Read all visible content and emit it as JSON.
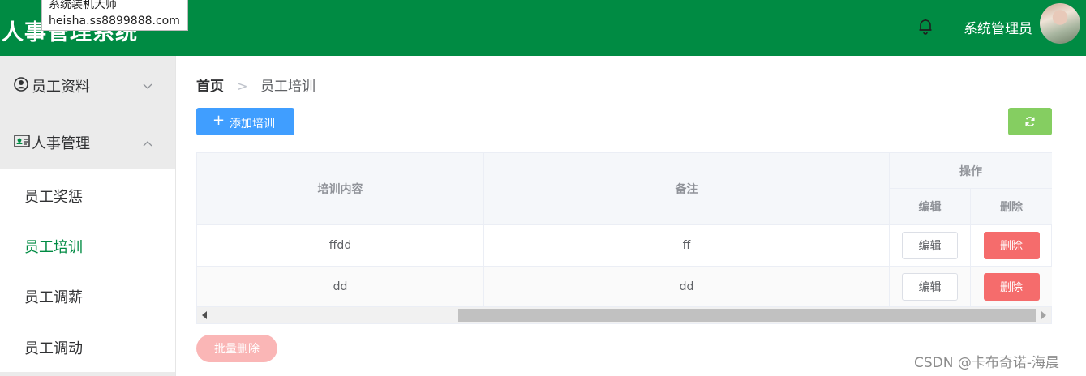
{
  "header": {
    "app_title": "人事管理系统",
    "username": "系统管理员"
  },
  "tooltip": {
    "line1": "系统装机大师",
    "line2": "heisha.ss8899888.com"
  },
  "sidebar": {
    "groups": [
      {
        "label": "员工资料",
        "icon": "user-circle-icon",
        "expanded": false
      },
      {
        "label": "人事管理",
        "icon": "id-card-icon",
        "expanded": true
      }
    ],
    "items": [
      {
        "label": "员工奖惩",
        "active": false
      },
      {
        "label": "员工培训",
        "active": true
      },
      {
        "label": "员工调薪",
        "active": false
      },
      {
        "label": "员工调动",
        "active": false
      }
    ]
  },
  "breadcrumb": {
    "home": "首页",
    "separator": ">",
    "current": "员工培训"
  },
  "toolbar": {
    "add_label": "添加培训",
    "refresh_icon": "refresh-icon"
  },
  "table": {
    "columns": {
      "content": "培训内容",
      "remark": "备注",
      "operation": "操作",
      "edit": "编辑",
      "delete": "删除"
    },
    "rows": [
      {
        "content": "ffdd",
        "remark": "ff",
        "edit_label": "编辑",
        "delete_label": "删除"
      },
      {
        "content": "dd",
        "remark": "dd",
        "edit_label": "编辑",
        "delete_label": "删除"
      }
    ]
  },
  "footer": {
    "batch_delete_label": "批量删除"
  },
  "watermark": "CSDN @卡布奇诺-海晨",
  "colors": {
    "header_bg": "#008b43",
    "active_menu": "#008b43",
    "primary": "#409eff",
    "success": "#85ce61",
    "danger": "#f56c6c",
    "danger_light": "#fab6b6"
  }
}
